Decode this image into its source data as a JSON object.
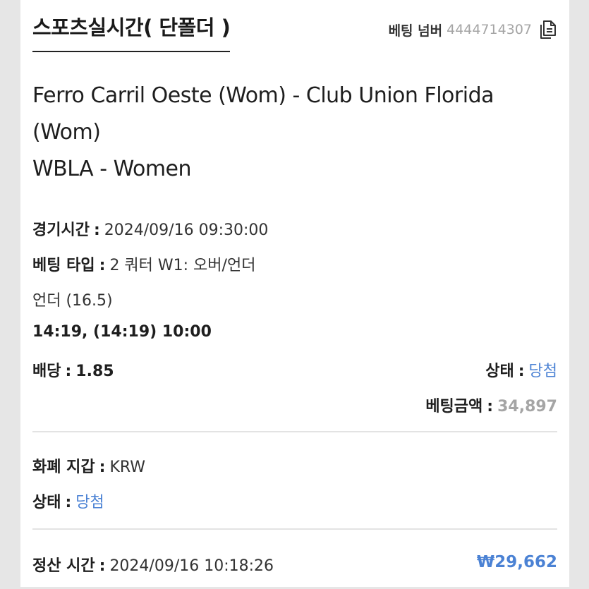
{
  "header": {
    "title": "스포츠실시간( 단폴더 )",
    "bet_number_label": "베팅 넘버",
    "bet_number_value": "4444714307"
  },
  "match": {
    "teams": "Ferro Carril Oeste (Wom) - Club Union Florida (Wom)",
    "league": "WBLA - Women"
  },
  "details": {
    "game_time_label": "경기시간",
    "game_time_value": "2024/09/16 09:30:00",
    "bet_type_label": "베팅 타입",
    "bet_type_value": "2 쿼터 W1: 오버/언더",
    "selection": "언더 (16.5)",
    "score": "14:19, (14:19) 10:00",
    "odds_label": "배당",
    "odds_value": "1.85",
    "status_label": "상태",
    "status_value": "당첨",
    "bet_amount_label": "베팅금액",
    "bet_amount_value": "34,897"
  },
  "wallet": {
    "currency_label": "화폐 지갑",
    "currency_value": "KRW",
    "status_label": "상태",
    "status_value": "당첨"
  },
  "settlement": {
    "time_label": "정산 시간",
    "time_value": "2024/09/16 10:18:26",
    "payout": "₩29,662"
  },
  "colors": {
    "accent_blue": "#4b82d4",
    "muted_grey": "#a5a5a5"
  },
  "icons": {
    "copy": "copy-icon"
  }
}
